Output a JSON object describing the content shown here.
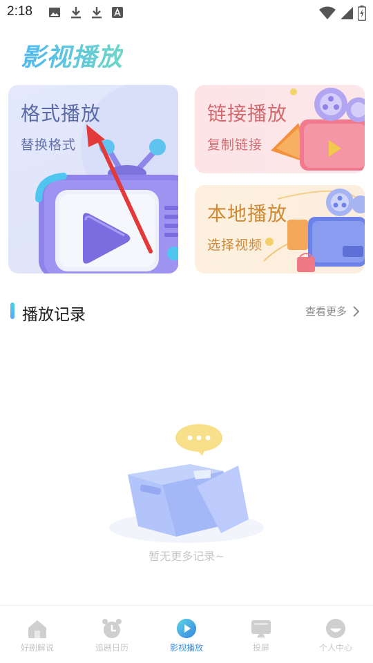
{
  "status_bar": {
    "time": "2:18",
    "left_icons": [
      "image-icon",
      "download-icon",
      "download-icon",
      "font-icon"
    ],
    "right_icons": [
      "wifi-icon",
      "signal-icon",
      "battery-charging-icon"
    ]
  },
  "app": {
    "logo_text": "影视播放"
  },
  "cards": {
    "format_play": {
      "title": "格式播放",
      "subtitle": "替换格式"
    },
    "link_play": {
      "title": "链接播放",
      "subtitle": "复制链接"
    },
    "local_play": {
      "title": "本地播放",
      "subtitle": "选择视频"
    }
  },
  "history": {
    "title": "播放记录",
    "see_more": "查看更多",
    "empty_text": "暂无更多记录~"
  },
  "tabbar": {
    "tabs": [
      {
        "label": "好剧解说",
        "icon": "home-icon",
        "active": false
      },
      {
        "label": "追剧日历",
        "icon": "alarm-clock-icon",
        "active": false
      },
      {
        "label": "影视播放",
        "icon": "play-circle-icon",
        "active": true
      },
      {
        "label": "投屏",
        "icon": "cast-screen-icon",
        "active": false
      },
      {
        "label": "个人中心",
        "icon": "profile-icon",
        "active": false
      }
    ]
  },
  "colors": {
    "accent": "#3e8fe0",
    "annotation_arrow": "#e23a3a",
    "inactive_tab": "#c6c6c6"
  }
}
